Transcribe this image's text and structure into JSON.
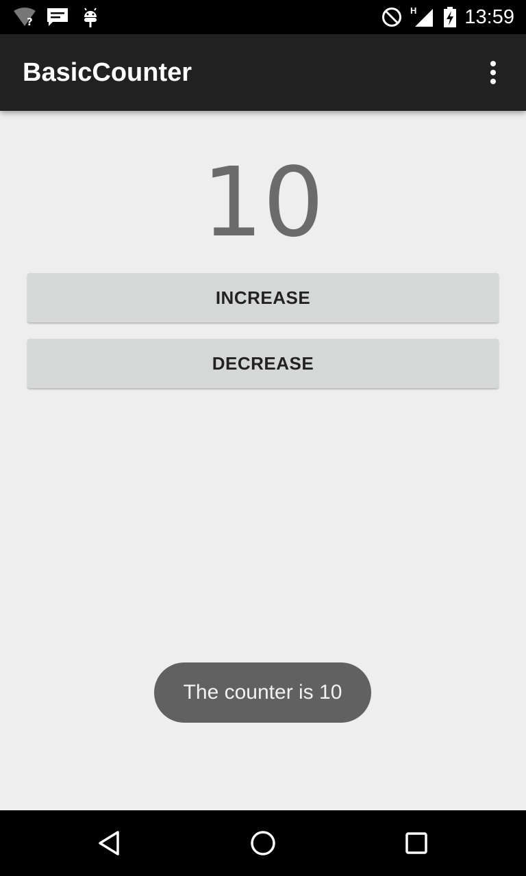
{
  "status_bar": {
    "time": "13:59",
    "network_type": "H",
    "icons": [
      "wifi-unknown-icon",
      "message-icon",
      "android-debug-icon",
      "do-not-disturb-icon",
      "cellular-signal-icon",
      "battery-charging-icon"
    ]
  },
  "app_bar": {
    "title": "BasicCounter",
    "menu_icon": "more-vert-icon"
  },
  "main": {
    "counter_value": "10",
    "increase_label": "INCREASE",
    "decrease_label": "DECREASE"
  },
  "toast": {
    "message": "The counter is 10"
  },
  "nav_bar": {
    "icons": [
      "back-icon",
      "home-icon",
      "recents-icon"
    ]
  },
  "colors": {
    "status_bar": "#000000",
    "app_bar": "#212121",
    "background": "#eeeeee",
    "button": "#d6d7d7",
    "counter_text": "#6b6b6b",
    "toast": "#616161"
  }
}
